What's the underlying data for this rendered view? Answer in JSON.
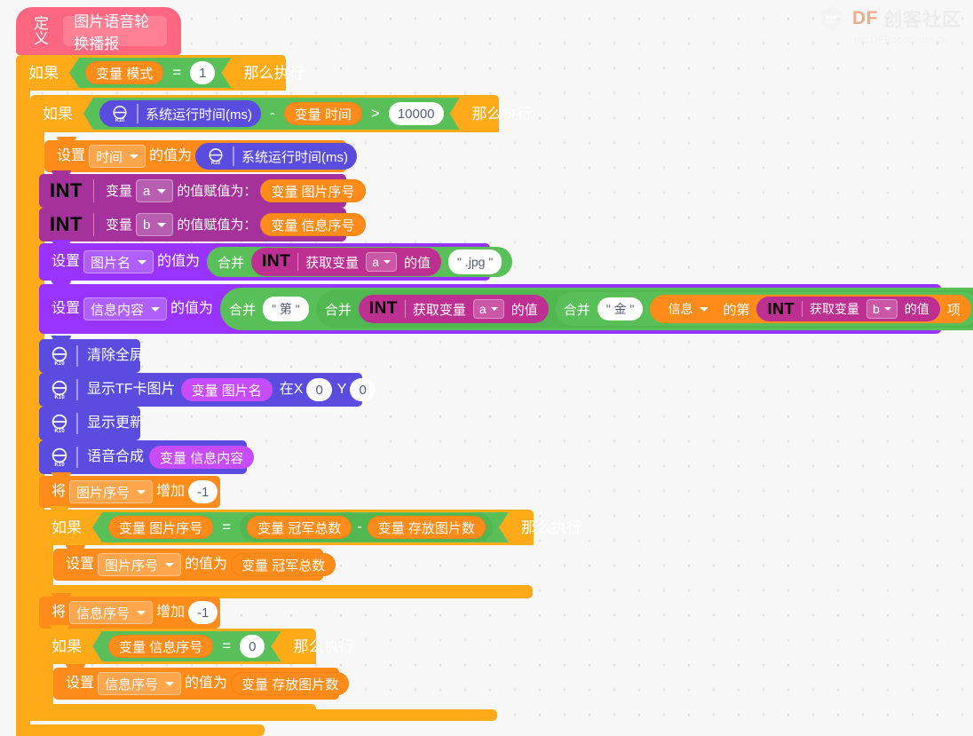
{
  "watermark": {
    "brand": "DF",
    "brand_cn": "创客社区",
    "url": "mc.DFRobot.com.cn",
    "logo_icon": "dfrobot-robot-head-icon"
  },
  "colors": {
    "background": "#f7f7f7",
    "define_pink": "#ff6680",
    "control_orange": "#ffab19",
    "operator_green": "#59c059",
    "variable_orange": "#ff8c1a",
    "purple_set": "#9933ff",
    "k10_indigo": "#5b4ce0",
    "int_magenta": "#bd2f90",
    "value_white": "#ffffff"
  },
  "program": {
    "define": {
      "keyword": "定义",
      "procedure_name": "图片语音轮换播报"
    },
    "if_mode": {
      "if_label": "如果",
      "then_label": "那么执行",
      "condition": {
        "left_var_prefix": "变量",
        "left_var_name": "模式",
        "operator": "=",
        "right_value": "1"
      }
    },
    "if_timer": {
      "if_label": "如果",
      "then_label": "那么执行",
      "condition": {
        "k10_icon": "k10-board-icon",
        "left_block": "系统运行时间(ms)",
        "minus": "-",
        "sub_var_prefix": "变量",
        "sub_var_name": "时间",
        "operator": ">",
        "right_value": "10000"
      }
    },
    "set_time": {
      "set_label": "设置",
      "field": "时间",
      "of_value_label": "的值为",
      "k10_icon": "k10-board-icon",
      "value_block": "系统运行时间(ms)"
    },
    "int_a": {
      "type_label": "INT",
      "var_label": "变量",
      "field": "a",
      "assign_label": "的值赋值为：",
      "value_prefix": "变量",
      "value_name": "图片序号"
    },
    "int_b": {
      "type_label": "INT",
      "var_label": "变量",
      "field": "b",
      "assign_label": "的值赋值为：",
      "value_prefix": "变量",
      "value_name": "信息序号"
    },
    "set_imagename": {
      "set_label": "设置",
      "field": "图片名",
      "of_value_label": "的值为",
      "join_label": "合并",
      "int_label": "INT",
      "get_var_label": "获取变量",
      "var_field": "a",
      "value_suffix_label": "的值",
      "string_literal": "\" .jpg \""
    },
    "set_message": {
      "set_label": "设置",
      "field": "信息内容",
      "of_value_label": "的值为",
      "join1_label": "合并",
      "str1": "\" 第 \"",
      "join2_label": "合并",
      "int_label": "INT",
      "get_var_label": "获取变量",
      "var_field_a": "a",
      "value_suffix_label": "的值",
      "join3_label": "合并",
      "str2": "\" 金 \"",
      "list_name": "信息",
      "item_label": "的第",
      "int_label2": "INT",
      "get_var_label2": "获取变量",
      "var_field_b": "b",
      "value_suffix_label2": "的值",
      "item_suffix": "项"
    },
    "clear_screen": {
      "k10_icon": "k10-board-icon",
      "label": "清除全屏"
    },
    "show_tf_image": {
      "k10_icon": "k10-board-icon",
      "label": "显示TF卡图片",
      "var_prefix": "变量",
      "var_name": "图片名",
      "x_label": "在X",
      "x_value": "0",
      "y_label": "Y",
      "y_value": "0"
    },
    "show_update": {
      "k10_icon": "k10-board-icon",
      "label": "显示更新"
    },
    "speech_synthesis": {
      "k10_icon": "k10-board-icon",
      "label": "语音合成",
      "var_prefix": "变量",
      "var_name": "信息内容"
    },
    "change_image_index": {
      "change_label": "将",
      "field": "图片序号",
      "by_label": "增加",
      "value": "-1"
    },
    "if_image_index": {
      "if_label": "如果",
      "then_label": "那么执行",
      "condition": {
        "left_prefix": "变量",
        "left_name": "图片序号",
        "operator": "=",
        "r1_prefix": "变量",
        "r1_name": "冠军总数",
        "minus": "-",
        "r2_prefix": "变量",
        "r2_name": "存放图片数"
      },
      "body": {
        "set_label": "设置",
        "field": "图片序号",
        "of_value_label": "的值为",
        "value_prefix": "变量",
        "value_name": "冠军总数"
      }
    },
    "change_message_index": {
      "change_label": "将",
      "field": "信息序号",
      "by_label": "增加",
      "value": "-1"
    },
    "if_message_index": {
      "if_label": "如果",
      "then_label": "那么执行",
      "condition": {
        "left_prefix": "变量",
        "left_name": "信息序号",
        "operator": "=",
        "right_value": "0"
      },
      "body": {
        "set_label": "设置",
        "field": "信息序号",
        "of_value_label": "的值为",
        "value_prefix": "变量",
        "value_name": "存放图片数"
      }
    }
  }
}
